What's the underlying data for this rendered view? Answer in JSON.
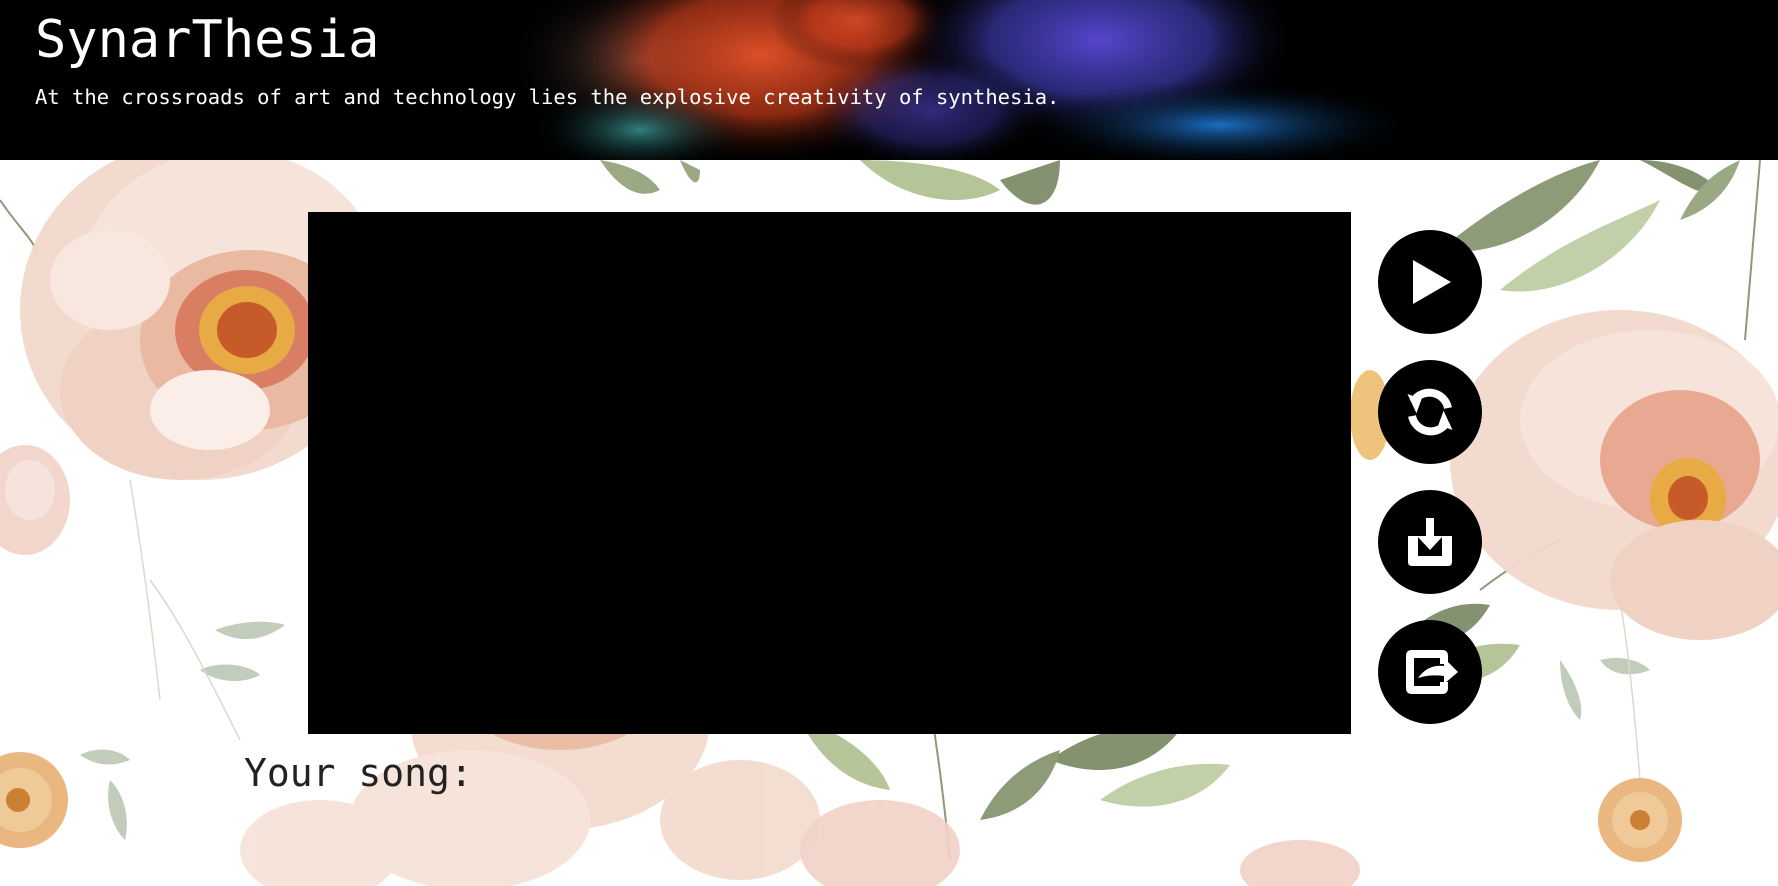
{
  "header": {
    "title": "SynarThesia",
    "tagline": "At the crossroads of art and technology lies the explosive creativity of synthesia."
  },
  "controls": [
    {
      "name": "play-button",
      "icon": "play-icon"
    },
    {
      "name": "refresh-button",
      "icon": "refresh-icon"
    },
    {
      "name": "download-button",
      "icon": "download-icon"
    },
    {
      "name": "share-button",
      "icon": "share-icon"
    }
  ],
  "song": {
    "label": "Your song:",
    "name": ""
  },
  "colors": {
    "header_bg": "#000000",
    "canvas_bg": "#000000",
    "button_bg": "#000000",
    "icon_fg": "#ffffff",
    "text_dark": "#222222"
  }
}
